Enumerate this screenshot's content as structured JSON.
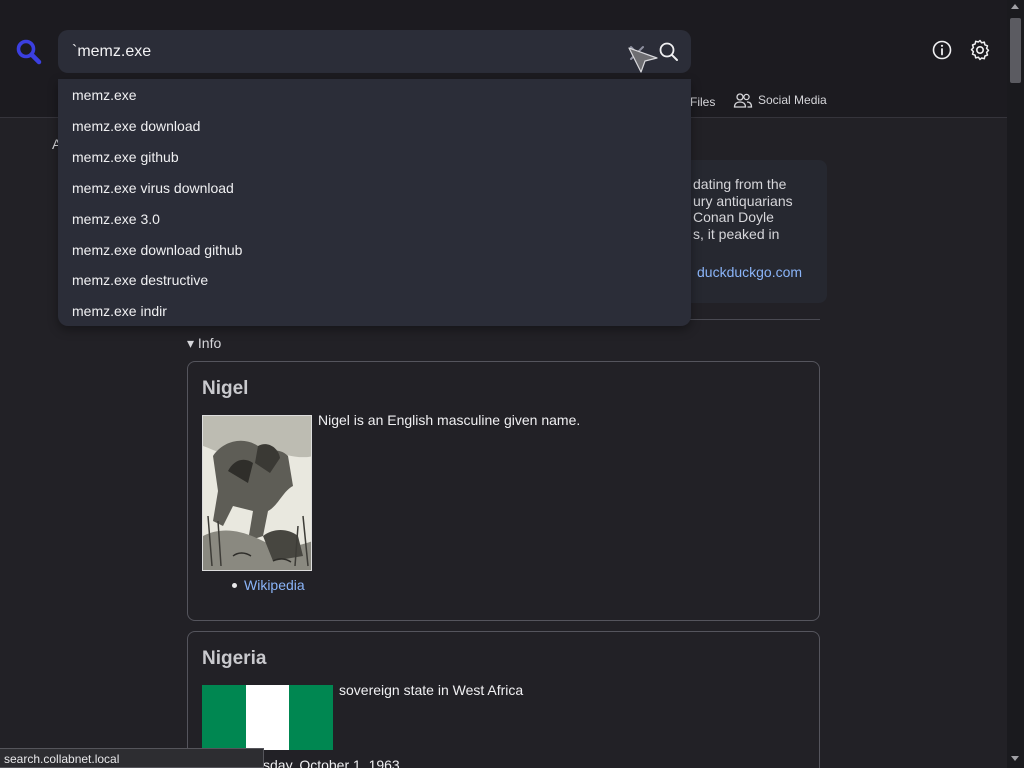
{
  "search": {
    "query": "`memz.exe"
  },
  "tabs": {
    "files_label": "Files",
    "social_label": "Social Media"
  },
  "suggestions": [
    "memz.exe",
    "memz.exe download",
    "memz.exe github",
    "memz.exe virus download",
    "memz.exe 3.0",
    "memz.exe download github",
    "memz.exe destructive",
    "memz.exe indir"
  ],
  "result_letter": "A",
  "abstract": {
    "lines": [
      "dating from the",
      "ury antiquarians",
      "Conan Doyle",
      "s, it peaked in"
    ],
    "source_link": "duckduckgo.com"
  },
  "info_toggle": "▾ Info",
  "cards": {
    "nigel": {
      "title": "Nigel",
      "description": "Nigel is an English masculine given name.",
      "link": "Wikipedia"
    },
    "nigeria": {
      "title": "Nigeria",
      "description": "sovereign state in West Africa",
      "date": "sday, October 1, 1963"
    }
  },
  "status_bar": "search.collabnet.local",
  "colors": {
    "background": "#222126",
    "accent": "#3b3fe0",
    "link": "#8ab4f8",
    "flag_green": "#008751"
  },
  "icons": [
    "magnifier-logo-icon",
    "clear-icon",
    "search-icon",
    "info-icon",
    "gear-icon",
    "people-icon"
  ]
}
